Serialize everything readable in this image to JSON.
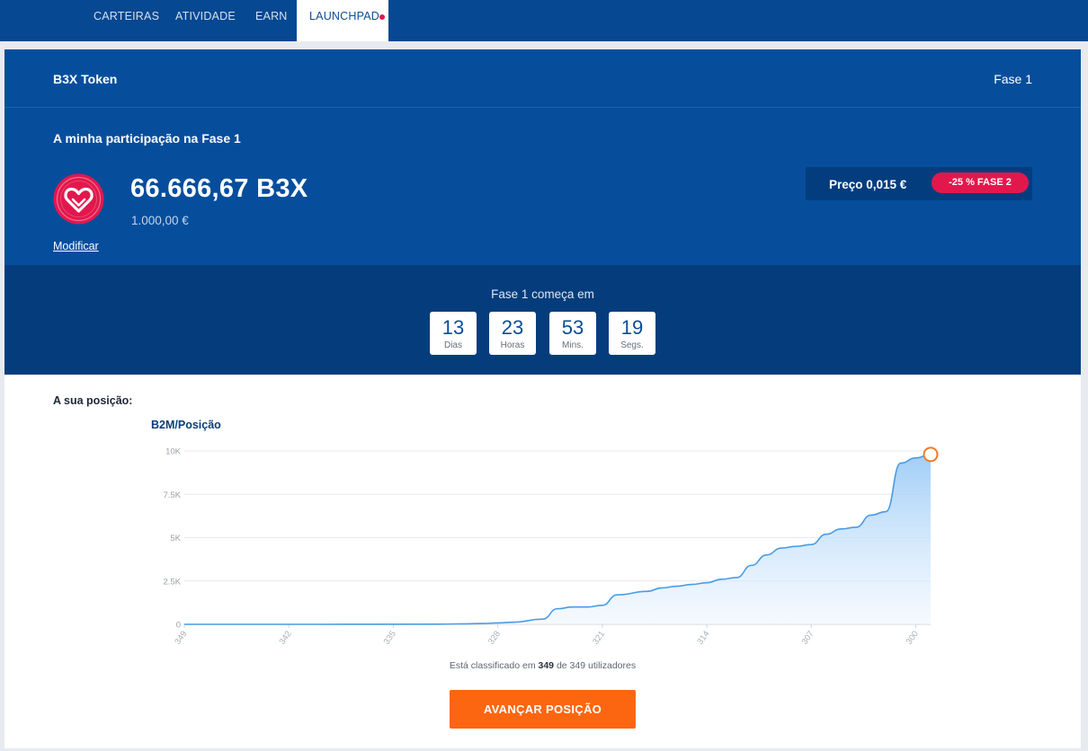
{
  "nav": {
    "tabs": [
      {
        "label": "CARTEIRAS",
        "active": false
      },
      {
        "label": "ATIVIDADE",
        "active": false
      },
      {
        "label": "EARN",
        "active": false
      },
      {
        "label": "LAUNCHPAD",
        "active": true,
        "notification_dot": true
      }
    ]
  },
  "token": {
    "name": "B3X Token",
    "phase": "Fase 1",
    "logo_icon": "heart-token-logo",
    "logo_color": "#e2184d"
  },
  "participation": {
    "title": "A minha participação na Fase 1",
    "amount": "66.666,67 B3X",
    "fiat": "1.000,00 €",
    "modify_label": "Modificar",
    "price": "Preço 0,015 €",
    "discount_badge": "-25 % FASE 2"
  },
  "countdown": {
    "title": "Fase 1 começa em",
    "units": [
      {
        "value": "13",
        "label": "Dias"
      },
      {
        "value": "23",
        "label": "Horas"
      },
      {
        "value": "53",
        "label": "Mins."
      },
      {
        "value": "19",
        "label": "Segs."
      }
    ]
  },
  "position": {
    "label": "A sua posição:",
    "rank_prefix": "Está classificado em ",
    "rank": "349",
    "rank_middle": " de ",
    "total": "349",
    "rank_suffix": " utilizadores",
    "button_label": "AVANÇAR POSIÇÃO"
  },
  "chart_data": {
    "type": "area",
    "title": "B2M/Posição",
    "xlabel": "",
    "ylabel": "",
    "x_reversed": true,
    "x_ticks": [
      "349",
      "342",
      "335",
      "328",
      "321",
      "314",
      "307",
      "300"
    ],
    "y_ticks": [
      "0",
      "2.5K",
      "5K",
      "7.5K",
      "10K"
    ],
    "ylim": [
      0,
      10000
    ],
    "xlim": [
      349,
      299
    ],
    "grid": true,
    "color": "#4a9be3",
    "marker_color": "#f07a2a",
    "series": [
      {
        "x": [
          349,
          340,
          332,
          330,
          329,
          328,
          327,
          325,
          324,
          323,
          322,
          321,
          320,
          318,
          317,
          316,
          315,
          314,
          313,
          312,
          311,
          310,
          309,
          308,
          307,
          306,
          305,
          304,
          303,
          302,
          301,
          300,
          299
        ],
        "values": [
          0,
          0,
          10,
          30,
          50,
          80,
          120,
          300,
          900,
          1000,
          1000,
          1100,
          1700,
          1900,
          2100,
          2200,
          2300,
          2400,
          2600,
          2700,
          3400,
          4000,
          4400,
          4500,
          4600,
          5200,
          5500,
          5600,
          6300,
          6500,
          9300,
          9600,
          9800
        ]
      }
    ]
  }
}
